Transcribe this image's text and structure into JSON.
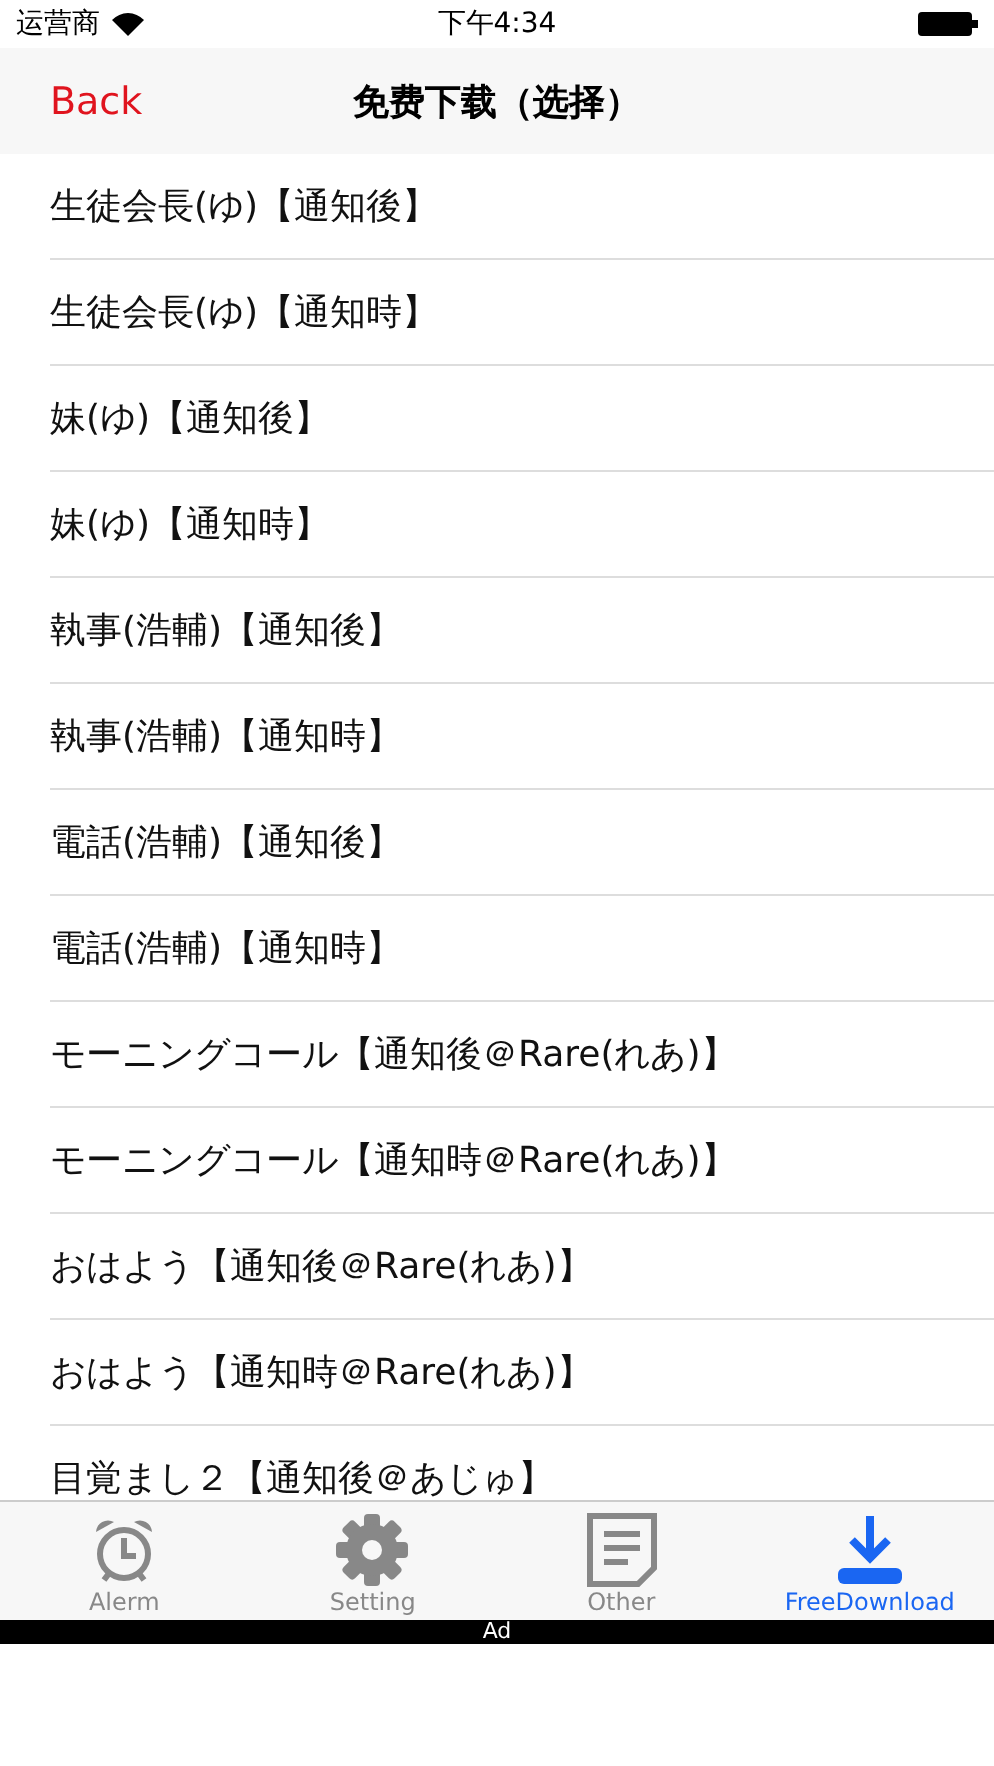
{
  "status_bar": {
    "carrier": "运营商",
    "time": "下午4:34"
  },
  "nav_bar": {
    "back": "Back",
    "title": "免费下载（选择）"
  },
  "list": {
    "items": [
      {
        "label": "生徒会長(ゆ)【通知後】"
      },
      {
        "label": "生徒会長(ゆ)【通知時】"
      },
      {
        "label": "妹(ゆ)【通知後】"
      },
      {
        "label": "妹(ゆ)【通知時】"
      },
      {
        "label": "執事(浩輔)【通知後】"
      },
      {
        "label": "執事(浩輔)【通知時】"
      },
      {
        "label": "電話(浩輔)【通知後】"
      },
      {
        "label": "電話(浩輔)【通知時】"
      },
      {
        "label": "モーニングコール【通知後＠Rare(れあ)】"
      },
      {
        "label": "モーニングコール【通知時＠Rare(れあ)】"
      },
      {
        "label": "おはよう【通知後＠Rare(れあ)】"
      },
      {
        "label": "おはよう【通知時＠Rare(れあ)】"
      },
      {
        "label": "目覚まし２【通知後＠あじゅ】"
      }
    ]
  },
  "tab_bar": {
    "tabs": [
      {
        "kind": "alarm",
        "label": "Alerm",
        "selected": false
      },
      {
        "kind": "gear",
        "label": "Setting",
        "selected": false
      },
      {
        "kind": "document",
        "label": "Other",
        "selected": false
      },
      {
        "kind": "download",
        "label": "FreeDownload",
        "selected": true
      }
    ]
  },
  "ad_bar": {
    "label": "Ad"
  }
}
